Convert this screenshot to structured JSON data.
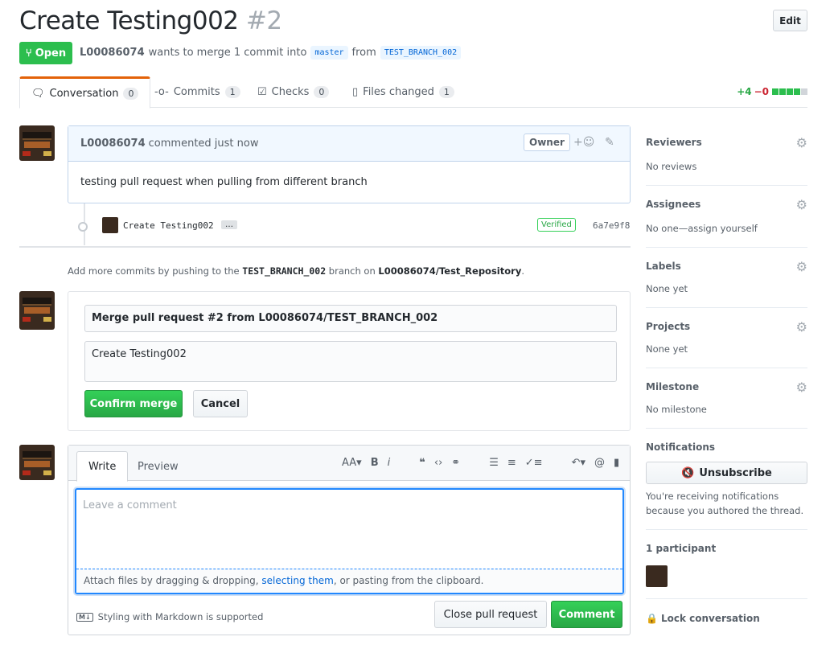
{
  "pr": {
    "title": "Create Testing002",
    "number": "#2",
    "edit_label": "Edit",
    "state": "Open",
    "author": "L00086074",
    "meta_text": "wants to merge 1 commit into",
    "base_branch": "master",
    "from_text": "from",
    "head_branch": "TEST_BRANCH_002"
  },
  "tabs": [
    {
      "label": "Conversation",
      "count": "0"
    },
    {
      "label": "Commits",
      "count": "1"
    },
    {
      "label": "Checks",
      "count": "0"
    },
    {
      "label": "Files changed",
      "count": "1"
    }
  ],
  "diffstat": {
    "additions": "+4",
    "deletions": "−0"
  },
  "comment": {
    "author": "L00086074",
    "when": "commented just now",
    "role": "Owner",
    "body": "testing pull request when pulling from different branch"
  },
  "commit": {
    "message": "Create Testing002",
    "more": "…",
    "verified": "Verified",
    "sha": "6a7e9f8"
  },
  "push_note": {
    "prefix": "Add more commits by pushing to the",
    "branch": "TEST_BRANCH_002",
    "middle": "branch on",
    "repo": "L00086074/Test_Repository",
    "suffix": "."
  },
  "merge": {
    "title": "Merge pull request #2 from L00086074/TEST_BRANCH_002",
    "message": "Create Testing002",
    "confirm_label": "Confirm merge",
    "cancel_label": "Cancel"
  },
  "new_comment": {
    "write_tab": "Write",
    "preview_tab": "Preview",
    "placeholder": "Leave a comment",
    "attach_prefix": "Attach files by dragging & dropping,",
    "attach_link": "selecting them",
    "attach_suffix": ", or pasting from the clipboard.",
    "markdown_note": "Styling with Markdown is supported",
    "markdown_icon": "M↓",
    "close_label": "Close pull request",
    "comment_label": "Comment"
  },
  "sidebar": {
    "reviewers": {
      "title": "Reviewers",
      "value": "No reviews"
    },
    "assignees": {
      "title": "Assignees",
      "value": "No one—assign yourself"
    },
    "labels": {
      "title": "Labels",
      "value": "None yet"
    },
    "projects": {
      "title": "Projects",
      "value": "None yet"
    },
    "milestone": {
      "title": "Milestone",
      "value": "No milestone"
    },
    "notifications": {
      "title": "Notifications",
      "button": "Unsubscribe",
      "text": "You're receiving notifications because you authored the thread."
    },
    "participants": "1 participant",
    "lock": "Lock conversation"
  },
  "colors": {
    "open_green": "#2cbe4e",
    "accent_orange": "#e36209",
    "link_blue": "#0366d6"
  }
}
